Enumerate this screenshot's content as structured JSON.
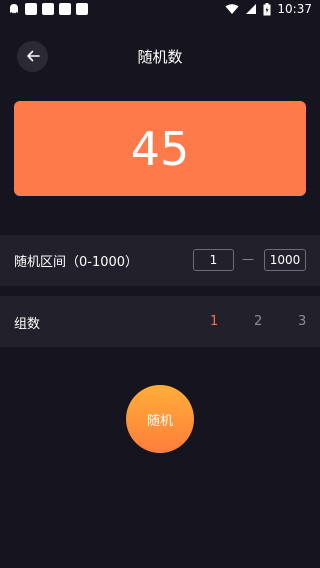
{
  "status_bar": {
    "time": "10:37",
    "battery_icon": "battery-charging-icon",
    "signal_icon": "signal-icon",
    "wifi_icon": "wifi-icon"
  },
  "header": {
    "title": "随机数",
    "back_icon": "arrow-left-icon"
  },
  "result": {
    "value": "45",
    "card_color": "#ff7a4a"
  },
  "range": {
    "label": "随机区间（0-1000）",
    "min_value": "1",
    "separator": "—",
    "max_value": "1000"
  },
  "groups": {
    "label": "组数",
    "options": [
      "1",
      "2",
      "3"
    ],
    "selected": "1",
    "accent_color": "#ff6b45"
  },
  "action": {
    "generate_label": "随机"
  }
}
